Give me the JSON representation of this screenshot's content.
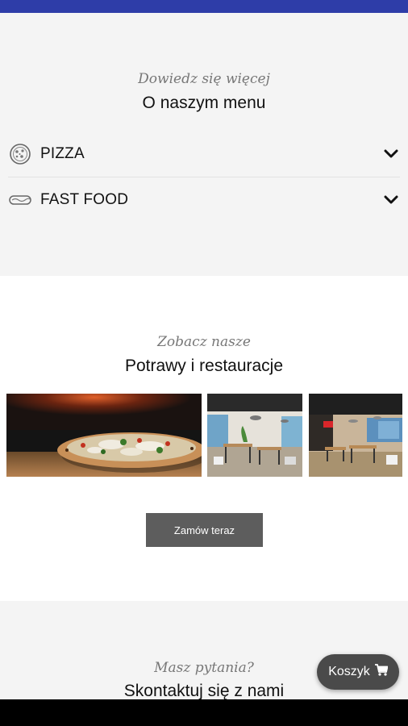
{
  "menu": {
    "subtitle": "Dowiedz się więcej",
    "title": "O naszym menu",
    "items": [
      {
        "label": "PIZZA",
        "icon": "pizza-icon"
      },
      {
        "label": "FAST FOOD",
        "icon": "hotdog-icon"
      }
    ]
  },
  "gallery": {
    "subtitle": "Zobacz nasze",
    "title": "Potrawy i restauracje",
    "photos": [
      "pizza-photo",
      "restaurant-interior-photo",
      "restaurant-dining-photo"
    ],
    "order_button": "Zamów teraz"
  },
  "contact": {
    "subtitle": "Masz pytania?",
    "title": "Skontaktuj się z nami"
  },
  "cart": {
    "label": "Koszyk",
    "icon": "cart-icon"
  },
  "colors": {
    "topbar": "#2e3da8",
    "section_bg": "#f4f4f4",
    "button": "#5d5d5d",
    "cart_button": "#4a4a4a"
  }
}
